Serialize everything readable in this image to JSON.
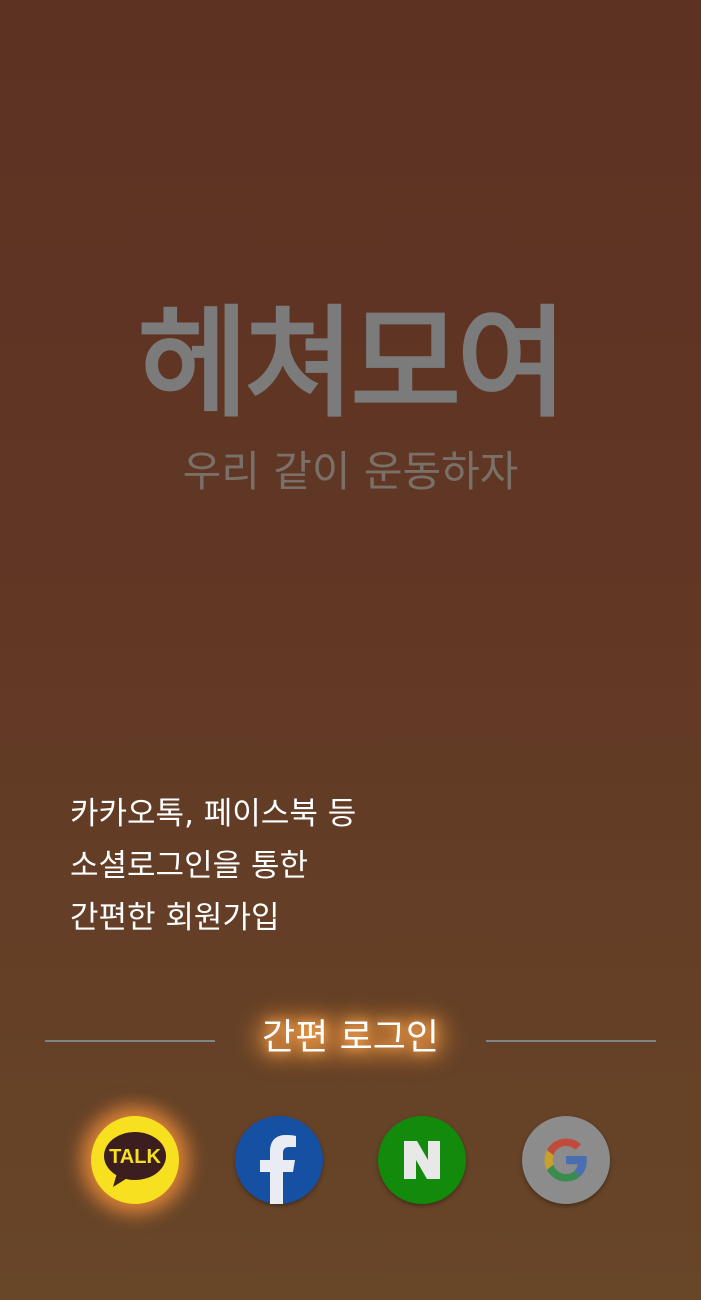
{
  "app": {
    "brand_title": "헤쳐모여",
    "slogan": "우리 같이 운동하자"
  },
  "intro": {
    "lines": [
      "카카오톡, 페이스북 등",
      "소셜로그인을 통한",
      "간편한 회원가입"
    ]
  },
  "login": {
    "section_label": "간편 로그인",
    "providers": [
      {
        "name": "kakao",
        "icon_text": "TALK",
        "icon": "kakao-talk-icon",
        "color": "#f7e01f"
      },
      {
        "name": "facebook",
        "icon_text": "f",
        "icon": "facebook-icon",
        "color": "#1550a3"
      },
      {
        "name": "naver",
        "icon_text": "N",
        "icon": "naver-icon",
        "color": "#128a0c"
      },
      {
        "name": "google",
        "icon_text": "G",
        "icon": "google-icon",
        "color": "#8c8c8c"
      }
    ]
  },
  "colors": {
    "background_top": "#5e3223",
    "background_bottom": "#684628",
    "glow": "#ff9a3a"
  }
}
